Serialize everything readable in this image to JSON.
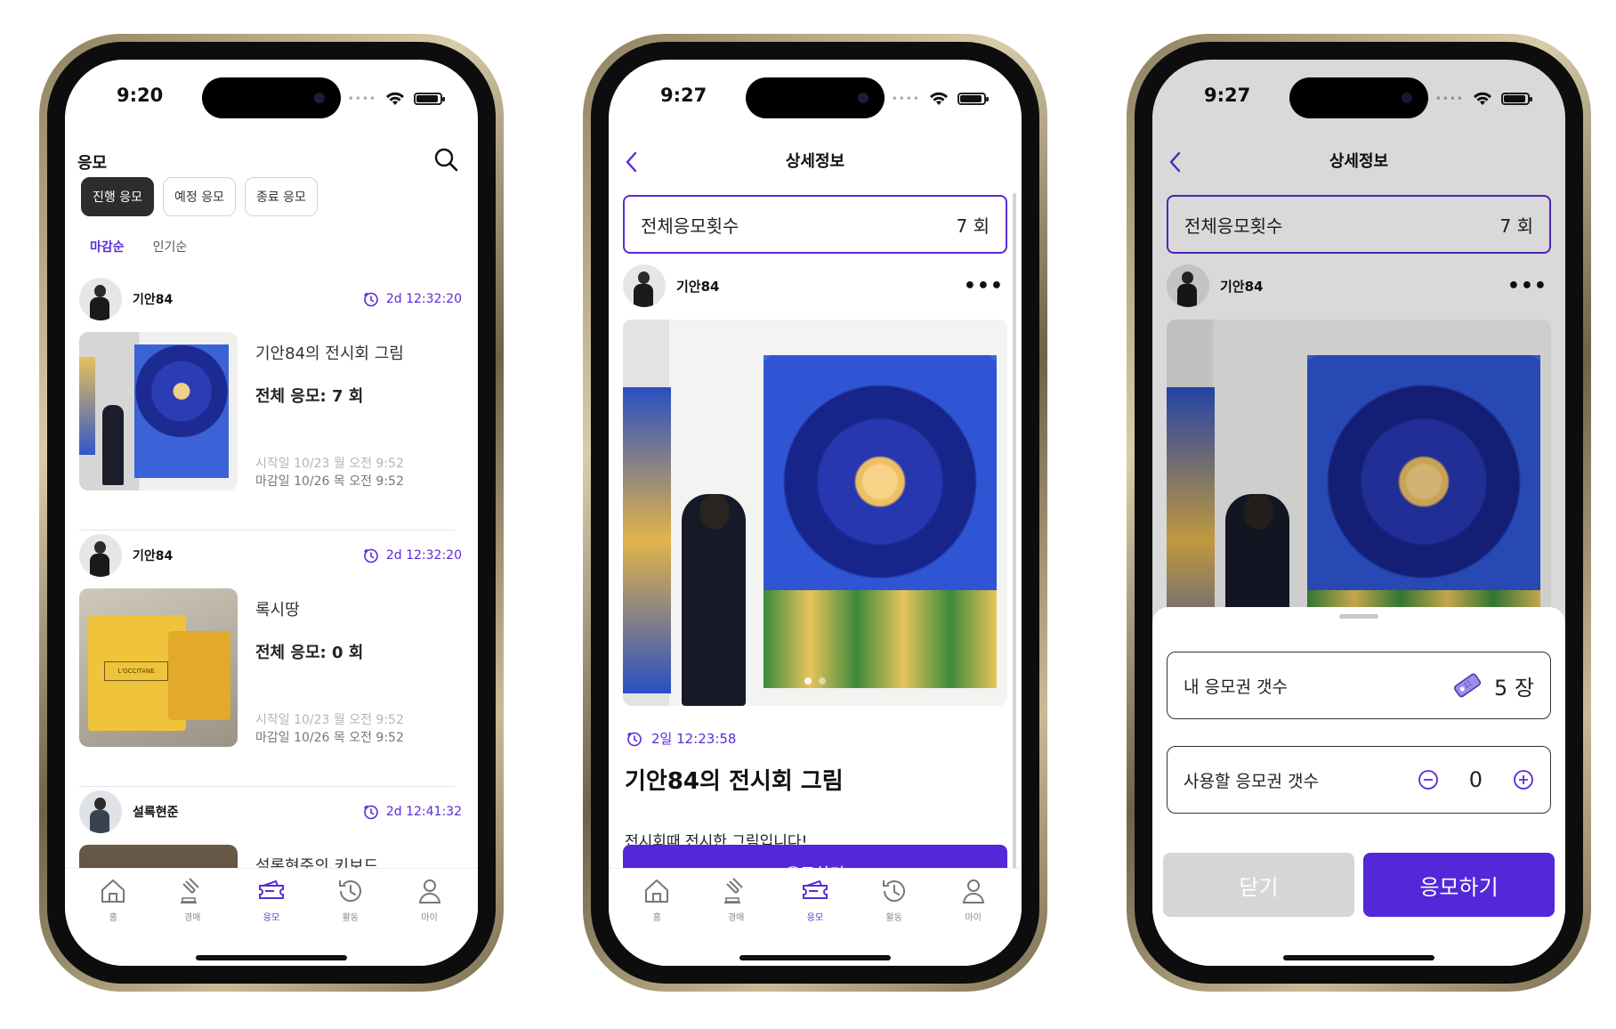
{
  "colors": {
    "accent": "#5b2bd6"
  },
  "phone1": {
    "status_time": "9:20",
    "title": "응모",
    "filters": [
      "진행 응모",
      "예정 응모",
      "종료 응모"
    ],
    "sort": [
      "마감순",
      "인기순"
    ],
    "items": [
      {
        "author": "기안84",
        "timer": "2d 12:32:20",
        "title": "기안84의 전시회 그림",
        "count": "전체 응모: 7 회",
        "start": "시작일  10/23 월 오전 9:52",
        "end": "마감일  10/26 목 오전 9:52"
      },
      {
        "author": "기안84",
        "timer": "2d 12:32:20",
        "title": "록시땅",
        "count": "전체 응모: 0 회",
        "start": "시작일  10/23 월 오전 9:52",
        "end": "마감일  10/26 목 오전 9:52"
      },
      {
        "author": "설록현준",
        "timer": "2d 12:41:32",
        "title": "설록현준의 키보드"
      }
    ],
    "tabs": [
      {
        "label": "홈",
        "icon": "home-icon"
      },
      {
        "label": "경매",
        "icon": "gavel-icon"
      },
      {
        "label": "응모",
        "icon": "ticket-icon"
      },
      {
        "label": "활동",
        "icon": "history-icon"
      },
      {
        "label": "마이",
        "icon": "person-icon"
      }
    ]
  },
  "phone2": {
    "status_time": "9:27",
    "nav_title": "상세정보",
    "count_label": "전체응모횟수",
    "count_value": "7 회",
    "author": "기안84",
    "timer": "2일 12:23:58",
    "title": "기안84의 전시회 그림",
    "description": "전시회때 전시한 그림입니다!",
    "apply_label": "응모하기"
  },
  "phone3": {
    "status_time": "9:27",
    "nav_title": "상세정보",
    "count_label": "전체응모횟수",
    "count_value": "7 회",
    "author": "기안84",
    "my_tickets_label": "내 응모권 갯수",
    "my_tickets_value": "5 장",
    "use_tickets_label": "사용할 응모권 갯수",
    "use_tickets_value": "0",
    "close_label": "닫기",
    "apply_label": "응모하기"
  }
}
